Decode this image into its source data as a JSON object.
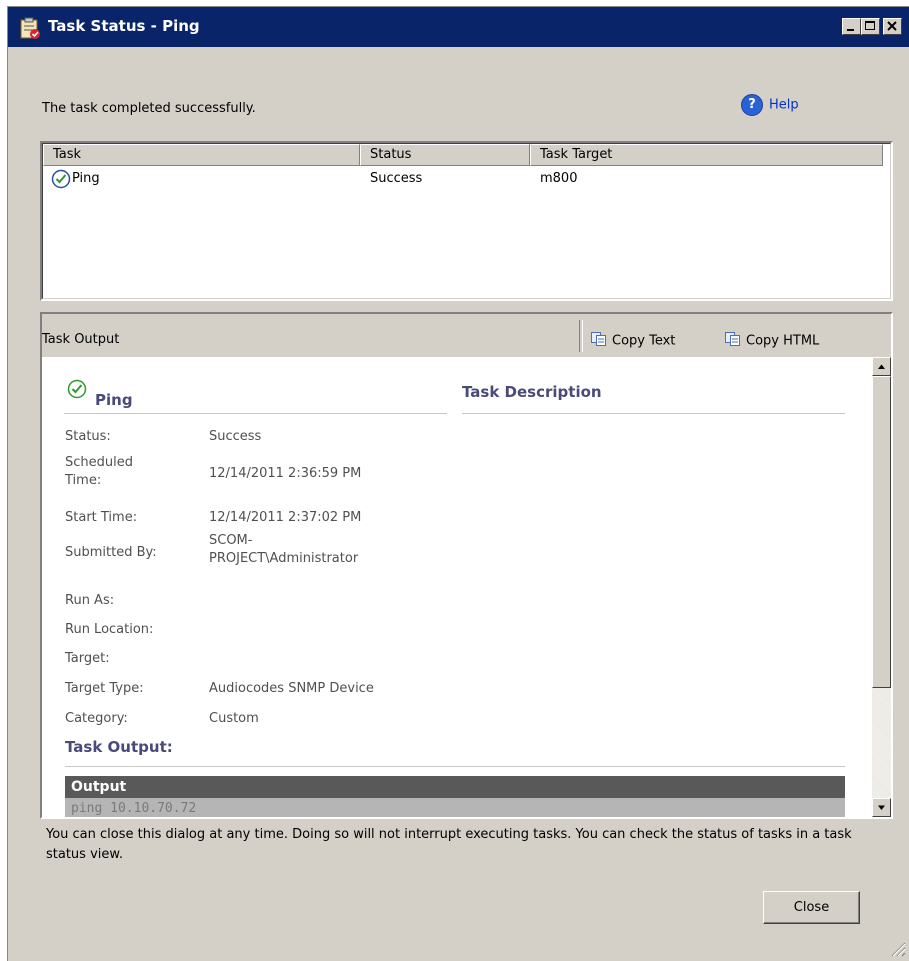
{
  "window": {
    "title": "Task Status - Ping"
  },
  "message": "The task completed successfully.",
  "help_label": "Help",
  "task_list": {
    "columns": [
      "Task",
      "Status",
      "Task Target"
    ],
    "rows": [
      {
        "task": "Ping",
        "status": "Success",
        "target": "m800"
      }
    ]
  },
  "output_panel": {
    "label": "Task Output",
    "copy_text_label": "Copy Text",
    "copy_html_label": "Copy HTML",
    "task_name": "Ping",
    "description_heading": "Task Description",
    "details": [
      {
        "label": "Status:",
        "value": "Success"
      },
      {
        "label": "Scheduled Time:",
        "value": "12/14/2011 2:36:59 PM"
      },
      {
        "label": "Start Time:",
        "value": "12/14/2011 2:37:02 PM"
      },
      {
        "label": "Submitted By:",
        "value": "SCOM-PROJECT\\Administrator"
      },
      {
        "label": "Run As:",
        "value": ""
      },
      {
        "label": "Run Location:",
        "value": ""
      },
      {
        "label": "Target:",
        "value": ""
      },
      {
        "label": "Target Type:",
        "value": "Audiocodes SNMP Device"
      },
      {
        "label": "Category:",
        "value": "Custom"
      }
    ],
    "output_heading": "Task Output:",
    "output_table_header": "Output",
    "output_first_line": "ping 10.10.70.72"
  },
  "footer_note": "You can close this dialog at any time.  Doing so will not interrupt executing tasks.  You can check the status of tasks in a task status view.",
  "close_label": "Close",
  "colors": {
    "titlebar": "#0a246a",
    "dialog_bg": "#d4d0c8",
    "section_heading": "#4a4a7a",
    "success_green": "#2e9a2e"
  },
  "icons": {
    "title": "task-status-icon",
    "help": "help-icon",
    "status": "success-check-icon",
    "copy": "copy-icon"
  }
}
